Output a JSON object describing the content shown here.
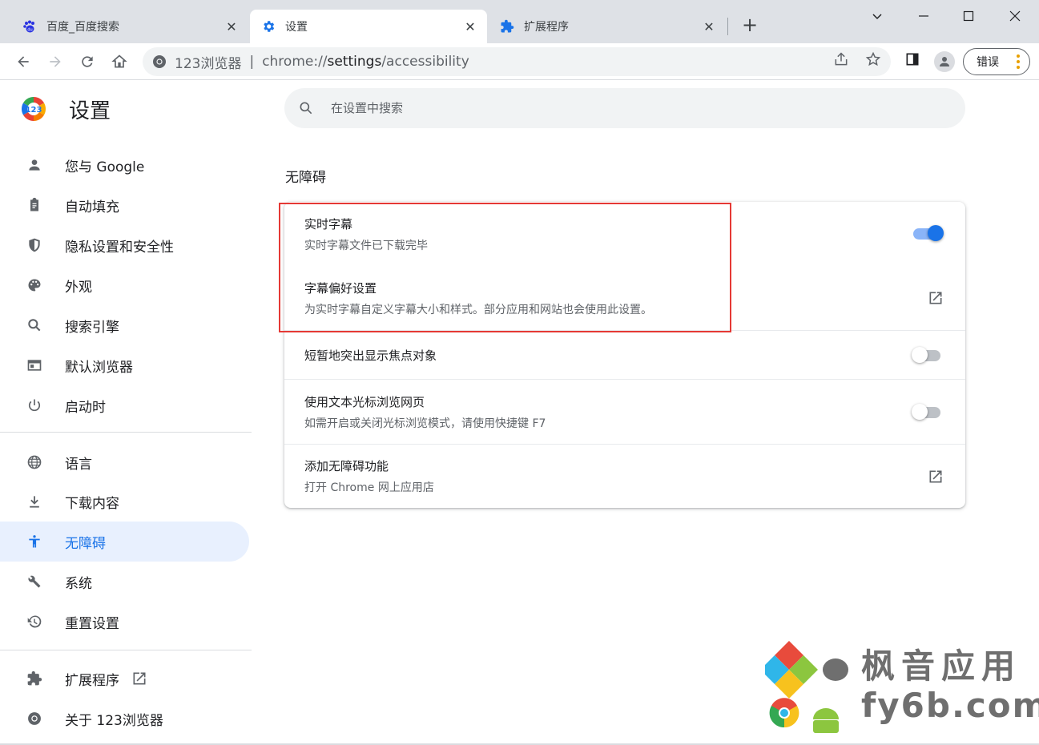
{
  "tabs": [
    {
      "title": "百度_百度搜索",
      "icon": "baidu-paw-icon",
      "active": false
    },
    {
      "title": "设置",
      "icon": "gear-icon",
      "active": true
    },
    {
      "title": "扩展程序",
      "icon": "puzzle-icon",
      "active": false
    }
  ],
  "omnibox": {
    "site_name": "123浏览器",
    "separator": "|",
    "url_scheme": "chrome://",
    "url_host": "settings",
    "url_path": "/accessibility"
  },
  "toolbar": {
    "error_button_label": "错误"
  },
  "settings": {
    "title": "设置",
    "search_placeholder": "在设置中搜索"
  },
  "sidebar": {
    "items": [
      {
        "label": "您与 Google",
        "icon": "person-icon"
      },
      {
        "label": "自动填充",
        "icon": "clipboard-icon"
      },
      {
        "label": "隐私设置和安全性",
        "icon": "shield-icon"
      },
      {
        "label": "外观",
        "icon": "palette-icon"
      },
      {
        "label": "搜索引擎",
        "icon": "search-icon"
      },
      {
        "label": "默认浏览器",
        "icon": "browser-window-icon"
      },
      {
        "label": "启动时",
        "icon": "power-icon"
      },
      {
        "label": "语言",
        "icon": "globe-icon"
      },
      {
        "label": "下载内容",
        "icon": "download-icon"
      },
      {
        "label": "无障碍",
        "icon": "accessibility-icon",
        "active": true
      },
      {
        "label": "系统",
        "icon": "wrench-icon"
      },
      {
        "label": "重置设置",
        "icon": "restore-icon"
      },
      {
        "label": "扩展程序",
        "icon": "puzzle-icon"
      },
      {
        "label": "关于 123浏览器",
        "icon": "chrome-icon"
      }
    ]
  },
  "main": {
    "section_title": "无障碍",
    "rows": [
      {
        "label": "实时字幕",
        "sub": "实时字幕文件已下载完毕",
        "control": "toggle",
        "on": true
      },
      {
        "label": "字幕偏好设置",
        "sub": "为实时字幕自定义字幕大小和样式。部分应用和网站也会使用此设置。",
        "control": "external-link"
      },
      {
        "label": "短暂地突出显示焦点对象",
        "sub": "",
        "control": "toggle",
        "on": false
      },
      {
        "label": "使用文本光标浏览网页",
        "sub": "如需开启或关闭光标浏览模式，请使用快捷键 F7",
        "control": "toggle",
        "on": false
      },
      {
        "label": "添加无障碍功能",
        "sub": "打开 Chrome 网上应用店",
        "control": "external-link"
      }
    ]
  },
  "watermark": {
    "line1": "枫音应用",
    "line2": "fy6b.com"
  },
  "colors": {
    "accent": "#1a73e8",
    "active_nav_bg": "#e8f0fe",
    "highlight_border": "#e53935",
    "tabstrip_bg": "#dee1e6"
  }
}
